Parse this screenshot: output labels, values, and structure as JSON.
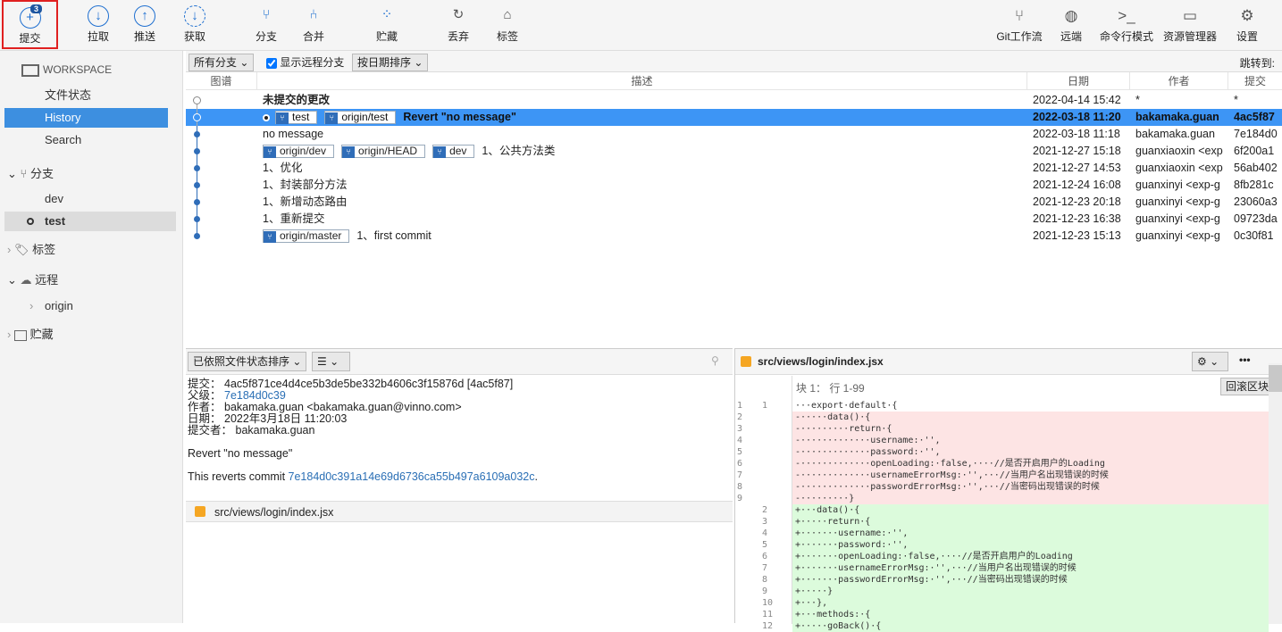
{
  "toolbar": {
    "left": [
      {
        "label": "提交",
        "icon": "plus-circle-icon",
        "badge": "3"
      },
      {
        "label": "拉取",
        "icon": "arrow-down-circle-icon"
      },
      {
        "label": "推送",
        "icon": "arrow-up-circle-icon"
      },
      {
        "label": "获取",
        "icon": "fetch-icon"
      },
      {
        "label": "分支",
        "icon": "branch-icon"
      },
      {
        "label": "合并",
        "icon": "merge-icon"
      },
      {
        "label": "贮藏",
        "icon": "stash-icon"
      },
      {
        "label": "丢弃",
        "icon": "discard-icon"
      },
      {
        "label": "标签",
        "icon": "tag-icon"
      }
    ],
    "right": [
      {
        "label": "Git工作流",
        "icon": "git-flow-icon"
      },
      {
        "label": "远端",
        "icon": "globe-icon"
      },
      {
        "label": "命令行模式",
        "icon": "terminal-icon"
      },
      {
        "label": "资源管理器",
        "icon": "folder-icon"
      },
      {
        "label": "设置",
        "icon": "gear-icon"
      }
    ]
  },
  "sidebar": {
    "workspace": "WORKSPACE",
    "items": [
      "文件状态",
      "History",
      "Search"
    ],
    "branches": "分支",
    "branch_items": [
      "dev",
      "test"
    ],
    "tags": "标签",
    "remotes": "远程",
    "remote_items": [
      "origin"
    ],
    "stashes": "贮藏"
  },
  "filters": {
    "branches": "所有分支",
    "show_remote": "显示远程分支",
    "show_remote_checked": true,
    "sort": "按日期排序",
    "jump": "跳转到:"
  },
  "columns": [
    "图谱",
    "描述",
    "日期",
    "作者",
    "提交"
  ],
  "commits": [
    {
      "tags": [],
      "desc": "未提交的更改",
      "date": "2022-04-14 15:42",
      "author": "*",
      "hash": "*",
      "bold": true
    },
    {
      "tags": [
        "test",
        "origin/test"
      ],
      "desc": "Revert \"no message\"",
      "date": "2022-03-18 11:20",
      "author": "bakamaka.guan",
      "hash": "4ac5f87",
      "selected": true
    },
    {
      "tags": [],
      "desc": "no message",
      "date": "2022-03-18 11:18",
      "author": "bakamaka.guan",
      "hash": "7e184d0"
    },
    {
      "tags": [
        "origin/dev",
        "origin/HEAD",
        "dev"
      ],
      "desc": "1、公共方法类",
      "date": "2021-12-27 15:18",
      "author": "guanxiaoxin <exp",
      "hash": "6f200a1"
    },
    {
      "tags": [],
      "desc": "1、优化",
      "date": "2021-12-27 14:53",
      "author": "guanxiaoxin <exp",
      "hash": "56ab402"
    },
    {
      "tags": [],
      "desc": "1、封装部分方法",
      "date": "2021-12-24 16:08",
      "author": "guanxinyi <exp-g",
      "hash": "8fb281c"
    },
    {
      "tags": [],
      "desc": "1、新增动态路由",
      "date": "2021-12-23 20:18",
      "author": "guanxinyi <exp-g",
      "hash": "23060a3"
    },
    {
      "tags": [],
      "desc": "1、重新提交",
      "date": "2021-12-23 16:38",
      "author": "guanxinyi <exp-g",
      "hash": "09723da"
    },
    {
      "tags": [
        "origin/master"
      ],
      "desc": "1、first commit",
      "date": "2021-12-23 15:13",
      "author": "guanxinyi <exp-g",
      "hash": "0c30f81"
    }
  ],
  "details": {
    "sort": "已依照文件状态排序",
    "commit_label": "提交：",
    "commit": "4ac5f871ce4d4ce5b3de5be332b4606c3f15876d [4ac5f87]",
    "parent_label": "父级：",
    "parent": "7e184d0c39",
    "author_label": "作者：",
    "author": "bakamaka.guan <bakamaka.guan@vinno.com>",
    "date_label": "日期：",
    "date": "2022年3月18日 11:20:03",
    "committer_label": "提交者：",
    "committer": "bakamaka.guan",
    "message": "Revert \"no message\"",
    "reverts_prefix": "This reverts commit ",
    "reverts_hash": "7e184d0c391a14e69d6736ca55b497a6109a032c",
    "reverts_suffix": ".",
    "file": "src/views/login/index.jsx"
  },
  "diff": {
    "file": "src/views/login/index.jsx",
    "hunk": "块 1： 行 1-99",
    "revert_hunk": "回滚区块",
    "lines": [
      [
        "1",
        "1",
        "ctx",
        "···export·default·{"
      ],
      [
        "2",
        "",
        "del",
        "-·····data()·{"
      ],
      [
        "3",
        "",
        "del",
        "-·········return·{"
      ],
      [
        "4",
        "",
        "del",
        "-·············username:·'',"
      ],
      [
        "5",
        "",
        "del",
        "-·············password:·'',"
      ],
      [
        "6",
        "",
        "del",
        "-·············openLoading:·false,····//是否开启用户的Loading"
      ],
      [
        "7",
        "",
        "del",
        "-·············usernameErrorMsg:·'',···//当用户名出现错误的时候"
      ],
      [
        "8",
        "",
        "del",
        "-·············passwordErrorMsg:·'',···//当密码出现错误的时候"
      ],
      [
        "9",
        "",
        "del",
        "-·········}"
      ],
      [
        "",
        "2",
        "add",
        "+···data()·{"
      ],
      [
        "",
        "3",
        "add",
        "+·····return·{"
      ],
      [
        "",
        "4",
        "add",
        "+·······username:·'',"
      ],
      [
        "",
        "5",
        "add",
        "+·······password:·'',"
      ],
      [
        "",
        "6",
        "add",
        "+·······openLoading:·false,····//是否开启用户的Loading"
      ],
      [
        "",
        "7",
        "add",
        "+·······usernameErrorMsg:·'',···//当用户名出现错误的时候"
      ],
      [
        "",
        "8",
        "add",
        "+·······passwordErrorMsg:·'',···//当密码出现错误的时候"
      ],
      [
        "",
        "9",
        "add",
        "+·····}"
      ],
      [
        "",
        "10",
        "add",
        "+···},"
      ],
      [
        "",
        "11",
        "add",
        "+···methods:·{"
      ],
      [
        "",
        "12",
        "add",
        "+·····goBack()·{"
      ]
    ]
  },
  "colors": {
    "accent": "#3d95f5",
    "deleted": "#fde4e4",
    "added": "#dcfbdc",
    "badge": "#1e56a0"
  }
}
